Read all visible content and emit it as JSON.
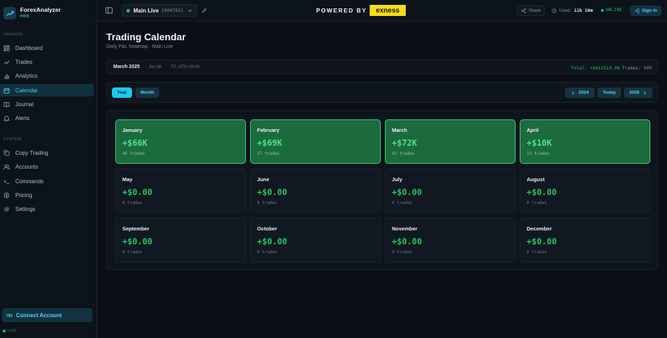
{
  "brand": {
    "name": "ForexAnalyzer",
    "tier": "PRO"
  },
  "sidebar": {
    "trading_label": "TRADING",
    "system_label": "SYSTEM",
    "trading_items": [
      {
        "label": "Dashboard",
        "icon": "grid-icon"
      },
      {
        "label": "Trades",
        "icon": "trend-icon"
      },
      {
        "label": "Analytics",
        "icon": "bar-chart-icon"
      },
      {
        "label": "Calendar",
        "icon": "calendar-icon",
        "active": true
      },
      {
        "label": "Journal",
        "icon": "book-icon"
      },
      {
        "label": "Alerts",
        "icon": "bell-icon"
      }
    ],
    "system_items": [
      {
        "label": "Copy Trading",
        "icon": "copy-icon"
      },
      {
        "label": "Accounts",
        "icon": "users-icon"
      },
      {
        "label": "Commands",
        "icon": "terminal-icon"
      },
      {
        "label": "Pricing",
        "icon": "dollar-icon"
      },
      {
        "label": "Settings",
        "icon": "gear-icon"
      }
    ],
    "connect_label": "Connect Account",
    "live_label": "LIVE"
  },
  "topbar": {
    "account_name": "Main Live",
    "account_number": "10047832",
    "powered_by": "POWERED BY",
    "partner": "exness",
    "share_label": "Share",
    "used_label": "Used:",
    "used_value": "11h 10m",
    "status": "ONLINE",
    "signin_label": "Sign in"
  },
  "page": {
    "title": "Trading Calendar",
    "subtitle": "Daily P&L heatmap · Main Live"
  },
  "info_bar": {
    "month": "March 2025",
    "date": "Jun 16",
    "timezone": "TZ: UTC+03:00",
    "total": "Total: +$412519.98",
    "trades": "Trades: 509"
  },
  "controls": {
    "year_label": "Year",
    "month_label": "Month",
    "prev_label": "2024",
    "today_label": "Today",
    "next_label": "2026"
  },
  "colors": {
    "accent": "#1ec8ee",
    "profit": "#22c55e",
    "positive_card": "#1c6b3f"
  },
  "months": [
    {
      "name": "January",
      "pnl": "+$66K",
      "trades": "46 trades",
      "positive": true
    },
    {
      "name": "February",
      "pnl": "+$69K",
      "trades": "37 trades",
      "positive": true
    },
    {
      "name": "March",
      "pnl": "+$72K",
      "trades": "42 trades",
      "positive": true
    },
    {
      "name": "April",
      "pnl": "+$10K",
      "trades": "13 trades",
      "positive": true
    },
    {
      "name": "May",
      "pnl": "+$0.00",
      "trades": "0 trades",
      "positive": false
    },
    {
      "name": "June",
      "pnl": "+$0.00",
      "trades": "0 trades",
      "positive": false
    },
    {
      "name": "July",
      "pnl": "+$0.00",
      "trades": "0 trades",
      "positive": false
    },
    {
      "name": "August",
      "pnl": "+$0.00",
      "trades": "0 trades",
      "positive": false
    },
    {
      "name": "September",
      "pnl": "+$0.00",
      "trades": "0 trades",
      "positive": false
    },
    {
      "name": "October",
      "pnl": "+$0.00",
      "trades": "0 trades",
      "positive": false
    },
    {
      "name": "November",
      "pnl": "+$0.00",
      "trades": "0 trades",
      "positive": false
    },
    {
      "name": "December",
      "pnl": "+$0.00",
      "trades": "0 trades",
      "positive": false
    }
  ]
}
